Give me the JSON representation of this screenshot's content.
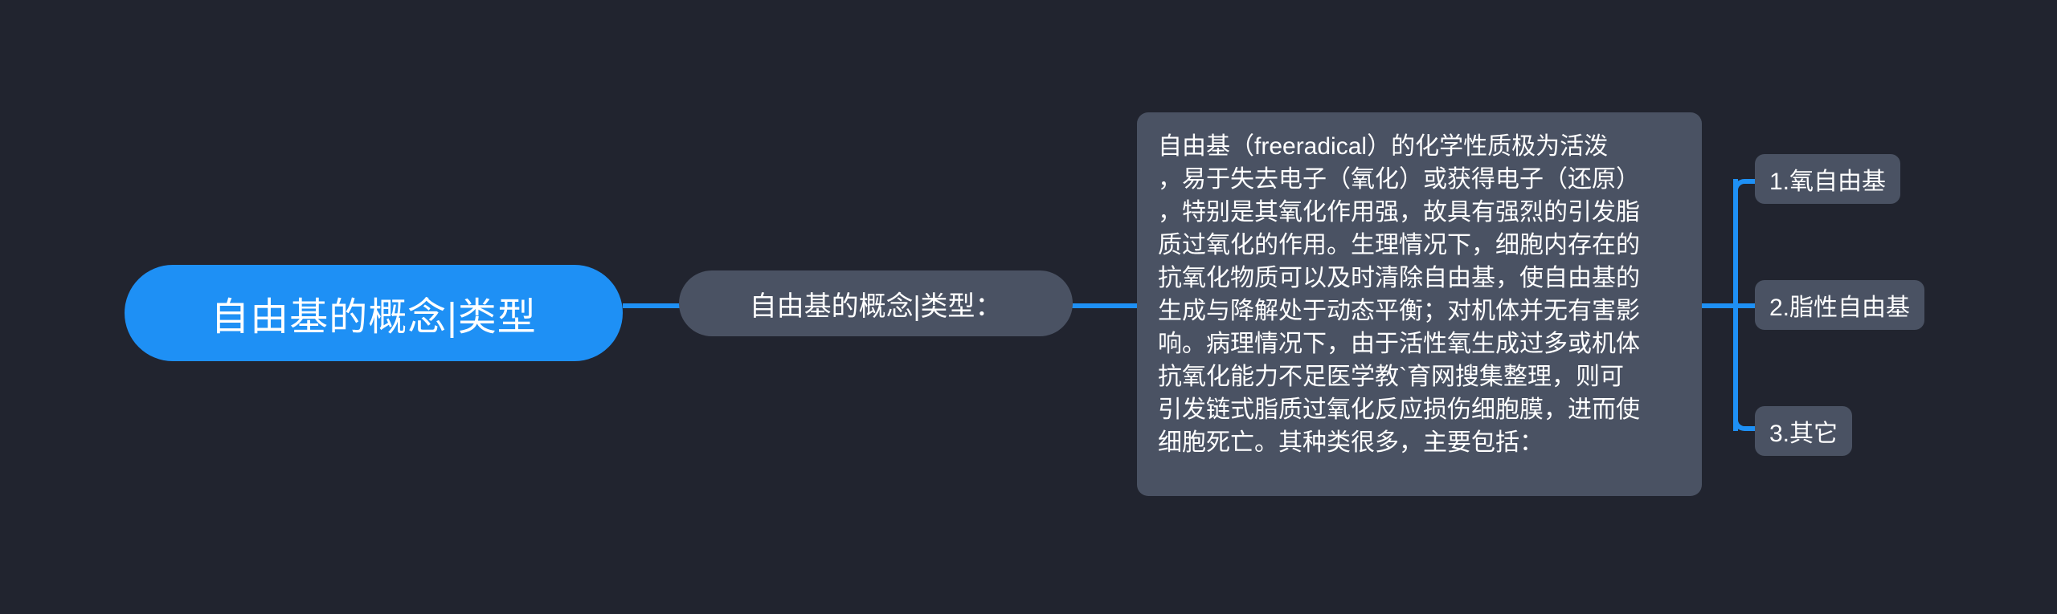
{
  "canvas": {
    "background_color": "#21242f",
    "accent_color": "#1e90f5",
    "node_color": "#4a5263",
    "text_color": "#ffffff"
  },
  "mindmap": {
    "root": {
      "label": "自由基的概念|类型"
    },
    "subtopic": {
      "label": "自由基的概念|类型："
    },
    "body": {
      "lines": [
        "自由基（freeradical）的化学性质极为活泼",
        "，易于失去电子（氧化）或获得电子（还原）",
        "，特别是其氧化作用强，故具有强烈的引发脂",
        "质过氧化的作用。生理情况下，细胞内存在的",
        "抗氧化物质可以及时清除自由基，使自由基的",
        "生成与降解处于动态平衡；对机体并无有害影",
        "响。病理情况下，由于活性氧生成过多或机体",
        "抗氧化能力不足医学教`育网搜集整理，则可",
        "引发链式脂质过氧化反应损伤细胞膜，进而使",
        "细胞死亡。其种类很多，主要包括："
      ],
      "full_text": "自由基（freeradical）的化学性质极为活泼，易于失去电子（氧化）或获得电子（还原），特别是其氧化作用强，故具有强烈的引发脂质过氧化的作用。生理情况下，细胞内存在的抗氧化物质可以及时清除自由基，使自由基的生成与降解处于动态平衡；对机体并无有害影响。病理情况下，由于活性氧生成过多或机体抗氧化能力不足医学教`育网搜集整理，则可引发链式脂质过氧化反应损伤细胞膜，进而使细胞死亡。其种类很多，主要包括："
    },
    "leaves": [
      {
        "label": "1.氧自由基"
      },
      {
        "label": "2.脂性自由基"
      },
      {
        "label": "3.其它"
      }
    ]
  }
}
